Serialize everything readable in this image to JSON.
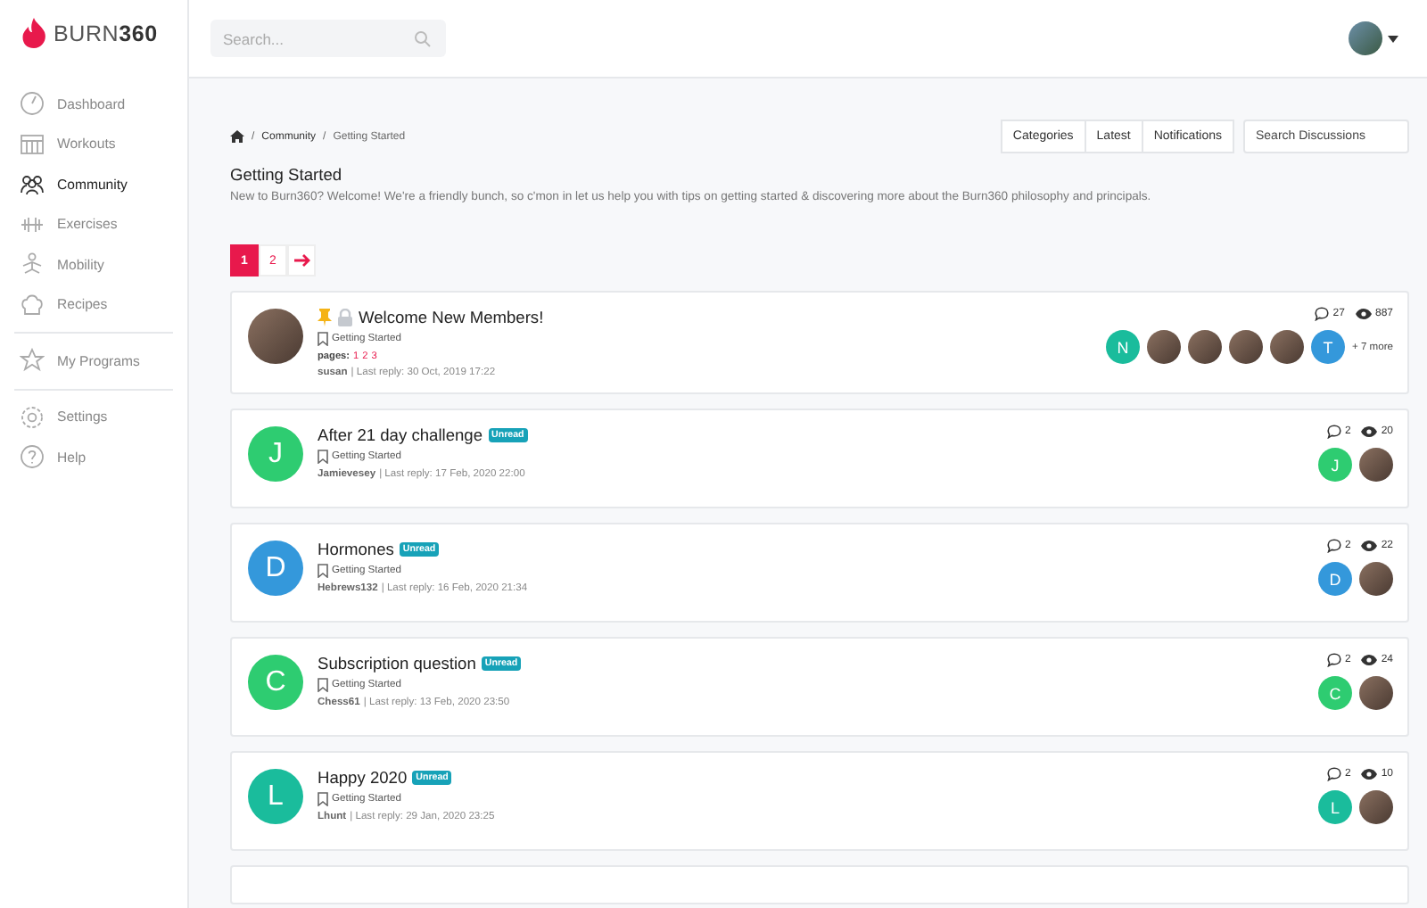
{
  "brand": {
    "name_light": "BURN",
    "name_bold": "360"
  },
  "search": {
    "placeholder": "Search..."
  },
  "sidebar": {
    "groups": [
      [
        {
          "label": "Dashboard",
          "selected": false
        },
        {
          "label": "Workouts",
          "selected": false
        },
        {
          "label": "Community",
          "selected": true
        },
        {
          "label": "Exercises",
          "selected": false
        },
        {
          "label": "Mobility",
          "selected": false
        },
        {
          "label": "Recipes",
          "selected": false
        }
      ],
      [
        {
          "label": "My Programs",
          "selected": false
        }
      ],
      [
        {
          "label": "Settings",
          "selected": false
        },
        {
          "label": "Help",
          "selected": false
        }
      ]
    ]
  },
  "breadcrumb_separator": "/",
  "breadcrumb": [
    "Community",
    "Getting Started"
  ],
  "nav_tabs": [
    "Categories",
    "Latest",
    "Notifications"
  ],
  "discussion_search": {
    "placeholder": "Search Discussions"
  },
  "category": {
    "title": "Getting Started",
    "description": "New to Burn360? Welcome! We're a friendly bunch, so c'mon in let us help you with tips on getting started & discovering more about the Burn360 philosophy and principals."
  },
  "pagination": [
    {
      "label": "1",
      "selected": true
    },
    {
      "label": "2",
      "selected": false
    }
  ],
  "topics": [
    {
      "avatar": {
        "kind": "photo"
      },
      "pinned": true,
      "locked": true,
      "title": "Welcome New Members!",
      "unread": false,
      "category": "Getting Started",
      "pages_label": "pages:",
      "pages": [
        "1",
        "2",
        "3"
      ],
      "author": "susan",
      "last_reply": "| Last reply: 30 Oct, 2019 17:22",
      "replies": "27",
      "views": "887",
      "participants": [
        {
          "kind": "letter",
          "letter": "N",
          "color": "#1abc9c"
        },
        {
          "kind": "photo"
        },
        {
          "kind": "photo"
        },
        {
          "kind": "photo"
        },
        {
          "kind": "photo"
        },
        {
          "kind": "letter",
          "letter": "T",
          "color": "#3498db"
        }
      ],
      "more": "+ 7 more"
    },
    {
      "avatar": {
        "kind": "letter",
        "letter": "J",
        "color": "#2ecc71"
      },
      "pinned": false,
      "locked": false,
      "title": "After 21 day challenge",
      "unread": true,
      "unread_label": "Unread",
      "category": "Getting Started",
      "author": "Jamievesey",
      "last_reply": "| Last reply: 17 Feb, 2020 22:00",
      "replies": "2",
      "views": "20",
      "participants": [
        {
          "kind": "letter",
          "letter": "J",
          "color": "#2ecc71"
        },
        {
          "kind": "photo"
        }
      ]
    },
    {
      "avatar": {
        "kind": "letter",
        "letter": "D",
        "color": "#3498db"
      },
      "pinned": false,
      "locked": false,
      "title": "Hormones",
      "unread": true,
      "unread_label": "Unread",
      "category": "Getting Started",
      "author": "Hebrews132",
      "last_reply": "| Last reply: 16 Feb, 2020 21:34",
      "replies": "2",
      "views": "22",
      "participants": [
        {
          "kind": "letter",
          "letter": "D",
          "color": "#3498db"
        },
        {
          "kind": "photo"
        }
      ]
    },
    {
      "avatar": {
        "kind": "letter",
        "letter": "C",
        "color": "#2ecc71"
      },
      "pinned": false,
      "locked": false,
      "title": "Subscription question",
      "unread": true,
      "unread_label": "Unread",
      "category": "Getting Started",
      "author": "Chess61",
      "last_reply": "| Last reply: 13 Feb, 2020 23:50",
      "replies": "2",
      "views": "24",
      "participants": [
        {
          "kind": "letter",
          "letter": "C",
          "color": "#2ecc71"
        },
        {
          "kind": "photo"
        }
      ]
    },
    {
      "avatar": {
        "kind": "letter",
        "letter": "L",
        "color": "#1abc9c"
      },
      "pinned": false,
      "locked": false,
      "title": "Happy 2020",
      "unread": true,
      "unread_label": "Unread",
      "category": "Getting Started",
      "author": "Lhunt",
      "last_reply": "| Last reply: 29 Jan, 2020 23:25",
      "replies": "2",
      "views": "10",
      "participants": [
        {
          "kind": "letter",
          "letter": "L",
          "color": "#1abc9c"
        },
        {
          "kind": "photo"
        }
      ]
    }
  ]
}
